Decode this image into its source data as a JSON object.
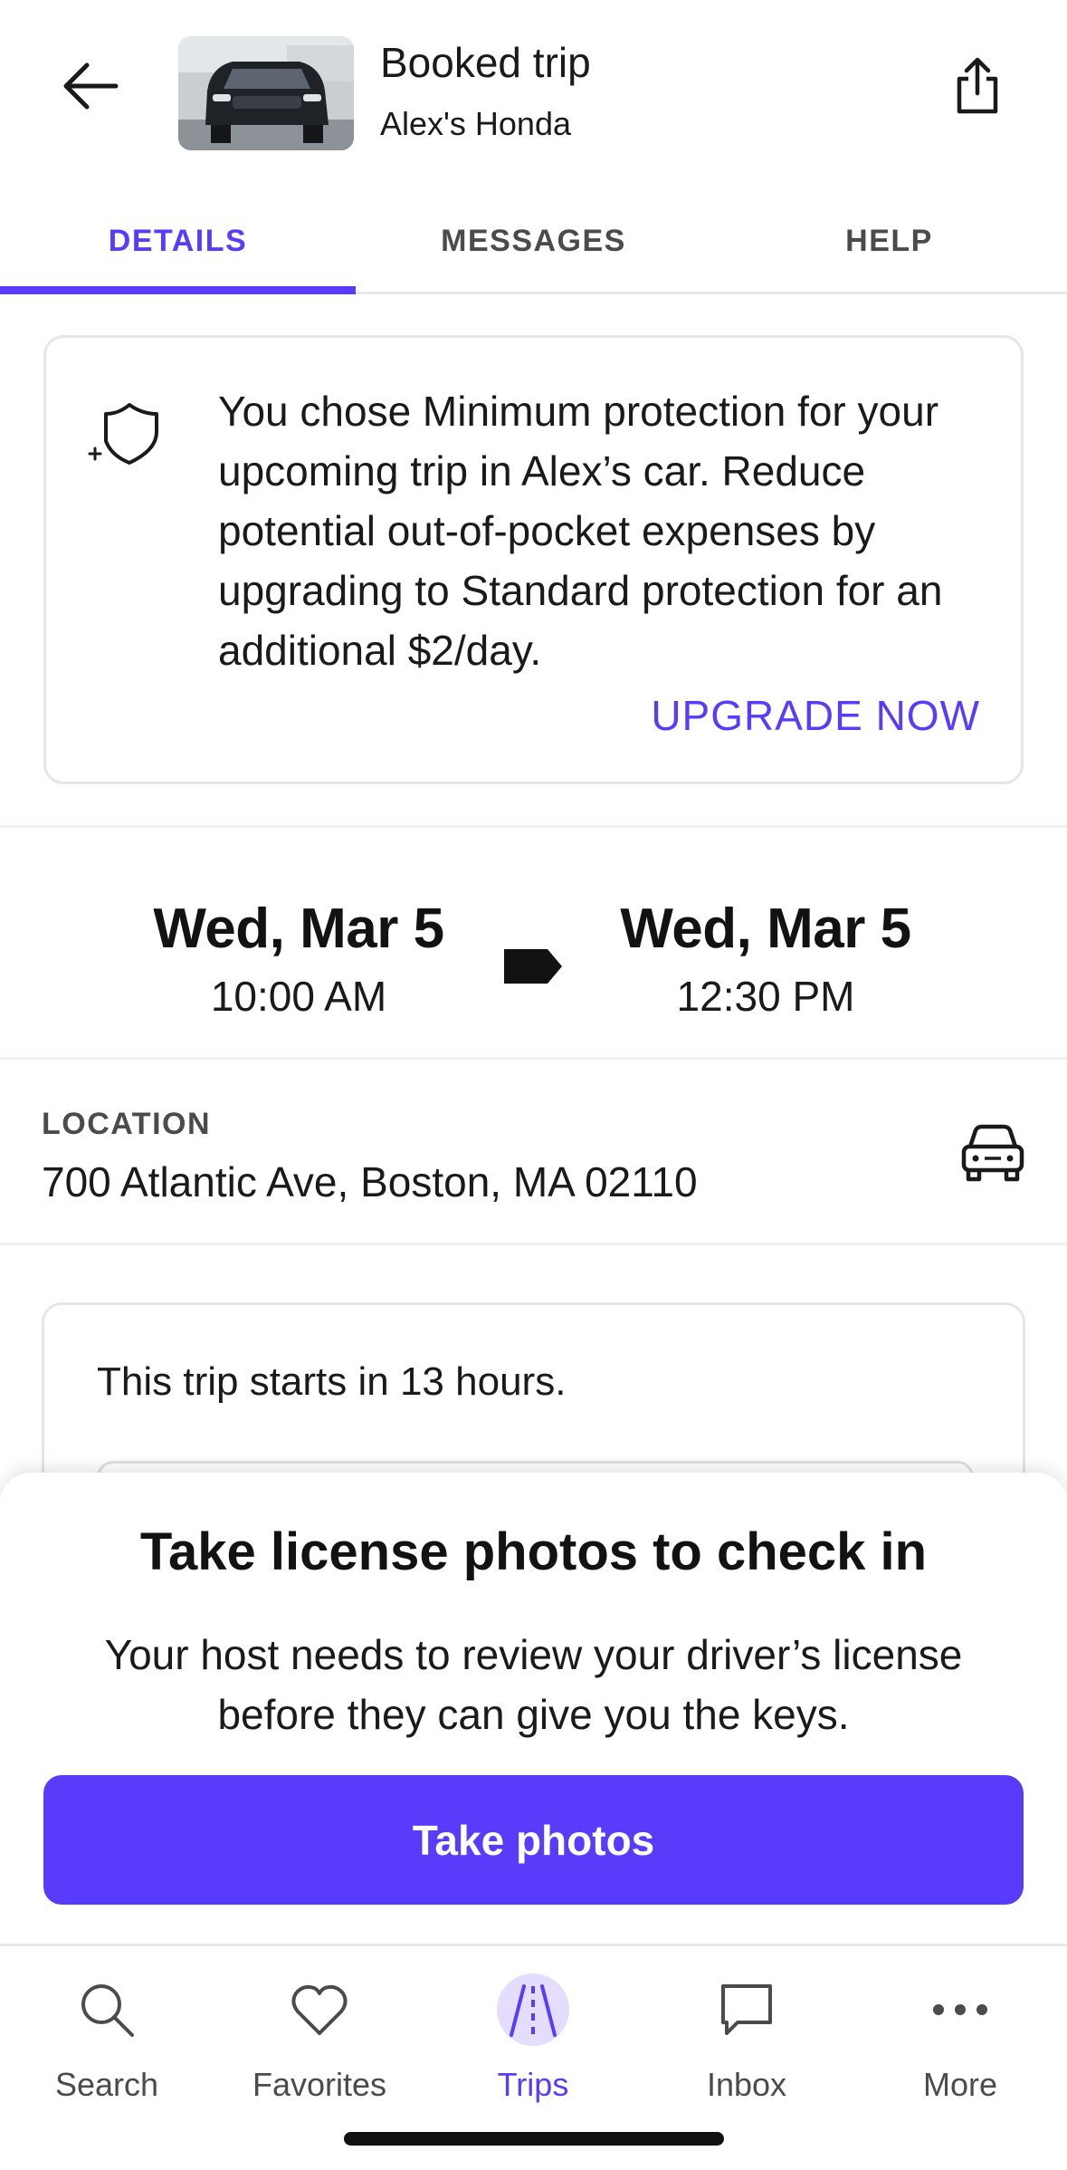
{
  "header": {
    "title": "Booked trip",
    "subtitle": "Alex's Honda"
  },
  "tabs": [
    {
      "label": "DETAILS",
      "active": true
    },
    {
      "label": "MESSAGES",
      "active": false
    },
    {
      "label": "HELP",
      "active": false
    }
  ],
  "protection": {
    "message": "You chose Minimum protection for your upcoming trip in Alex’s car. Reduce potential out-of-pocket expenses by upgrading to Standard protection for an additional $2/day.",
    "cta": "UPGRADE NOW"
  },
  "trip_dates": {
    "start": {
      "day": "Wed, Mar 5",
      "time": "10:00 AM"
    },
    "end": {
      "day": "Wed, Mar 5",
      "time": "12:30 PM"
    }
  },
  "location": {
    "label": "LOCATION",
    "address": "700 Atlantic Ave, Boston, MA 02110"
  },
  "trip_status": {
    "text": "This trip starts in 13 hours."
  },
  "checkin_sheet": {
    "title": "Take license photos to check in",
    "body": "Your host needs to review your driver’s license before they can give you the keys.",
    "button": "Take photos"
  },
  "bottom_nav": [
    {
      "label": "Search",
      "icon": "search-icon",
      "active": false
    },
    {
      "label": "Favorites",
      "icon": "heart-icon",
      "active": false
    },
    {
      "label": "Trips",
      "icon": "road-icon",
      "active": true
    },
    {
      "label": "Inbox",
      "icon": "chat-bubble-icon",
      "active": false
    },
    {
      "label": "More",
      "icon": "more-dots-icon",
      "active": false
    }
  ],
  "colors": {
    "accent": "#593cfb",
    "text": "#1a1a1a",
    "muted": "#4a4a4f",
    "border": "#e6e6ea"
  }
}
